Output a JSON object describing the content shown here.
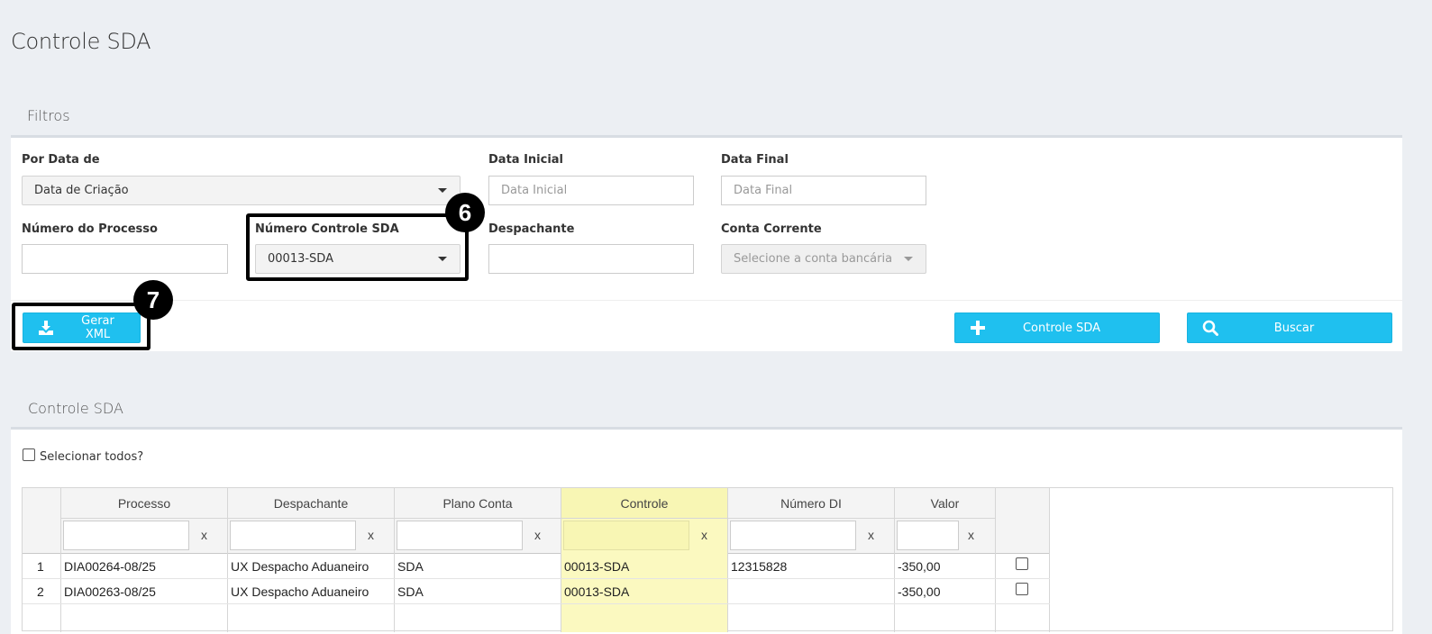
{
  "page": {
    "title": "Controle SDA"
  },
  "filters": {
    "heading": "Filtros",
    "por_data_de": {
      "label": "Por Data de",
      "value": "Data de Criação"
    },
    "data_inicial": {
      "label": "Data Inicial",
      "placeholder": "Data Inicial"
    },
    "data_final": {
      "label": "Data Final",
      "placeholder": "Data Final"
    },
    "numero_processo": {
      "label": "Número do Processo",
      "value": ""
    },
    "numero_controle_sda": {
      "label": "Número Controle SDA",
      "value": "00013-SDA"
    },
    "despachante": {
      "label": "Despachante",
      "value": ""
    },
    "conta_corrente": {
      "label": "Conta Corrente",
      "placeholder": "Selecione a conta bancária"
    }
  },
  "actions": {
    "gerar_xml": "Gerar XML",
    "controle_sda": "Controle SDA",
    "buscar": "Buscar"
  },
  "callouts": {
    "step6": "6",
    "step7": "7"
  },
  "results": {
    "heading": "Controle SDA",
    "select_all": "Selecionar todos?",
    "filter_clear": "x",
    "columns": [
      "Processo",
      "Despachante",
      "Plano Conta",
      "Controle",
      "Número DI",
      "Valor"
    ],
    "rows": [
      {
        "n": "1",
        "processo": "DIA00264-08/25",
        "despachante": "UX Despacho Aduaneiro",
        "plano": "SDA",
        "controle": "00013-SDA",
        "di": "12315828",
        "valor": "-350,00"
      },
      {
        "n": "2",
        "processo": "DIA00263-08/25",
        "despachante": "UX Despacho Aduaneiro",
        "plano": "SDA",
        "controle": "00013-SDA",
        "di": "",
        "valor": "-350,00"
      }
    ]
  },
  "colors": {
    "accent": "#1fc0ef",
    "highlight": "#fbf9c0",
    "background": "#eceff3"
  },
  "icons": {
    "gerar_xml": "download-icon",
    "controle_sda": "plus-icon",
    "buscar": "search-icon"
  }
}
